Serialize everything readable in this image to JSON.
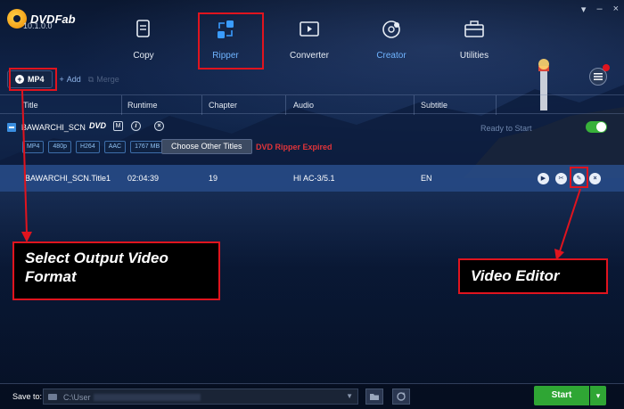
{
  "app": {
    "name": "DVDFab",
    "version": "10.1.0.0"
  },
  "window_controls": [
    "▾",
    "–",
    "×"
  ],
  "modes": [
    {
      "key": "copy",
      "label": "Copy",
      "icon": "copy-document-icon"
    },
    {
      "key": "ripper",
      "label": "Ripper",
      "icon": "ripper-arrows-icon"
    },
    {
      "key": "converter",
      "label": "Converter",
      "icon": "converter-film-icon"
    },
    {
      "key": "creator",
      "label": "Creator",
      "icon": "creator-disc-icon"
    },
    {
      "key": "utilities",
      "label": "Utilities",
      "icon": "utilities-toolbox-icon"
    }
  ],
  "toolbar": {
    "format_label": "MP4",
    "add_label": "Add",
    "merge_label": "Merge"
  },
  "columns": [
    "Title",
    "Runtime",
    "Chapter",
    "Audio",
    "Subtitle"
  ],
  "source": {
    "disc_name": "BAWARCHI_SCN",
    "dvd_logo": "DVD",
    "m_icon": "M",
    "info_icon": "i",
    "status": "Ready to Start",
    "chips": [
      "MP4",
      "480p",
      "H264",
      "AAC",
      "1767 MB"
    ],
    "choose_titles_label": "Choose Other Titles",
    "module_status": "DVD Ripper  Expired"
  },
  "title_row": {
    "title": "BAWARCHI_SCN.Title1",
    "runtime": "02:04:39",
    "chapter": "19",
    "audio": "HI AC-3/5.1",
    "subtitle": "EN"
  },
  "callouts": {
    "format": "Select Output Video Format",
    "editor": "Video Editor"
  },
  "bottom": {
    "save_to_label": "Save to:",
    "path": "C:\\User",
    "start_label": "Start"
  },
  "colors": {
    "accent_blue": "#6fb4ff",
    "highlight_red": "#e0141e",
    "start_green": "#2fa634",
    "row_selected": "#2c5496"
  }
}
